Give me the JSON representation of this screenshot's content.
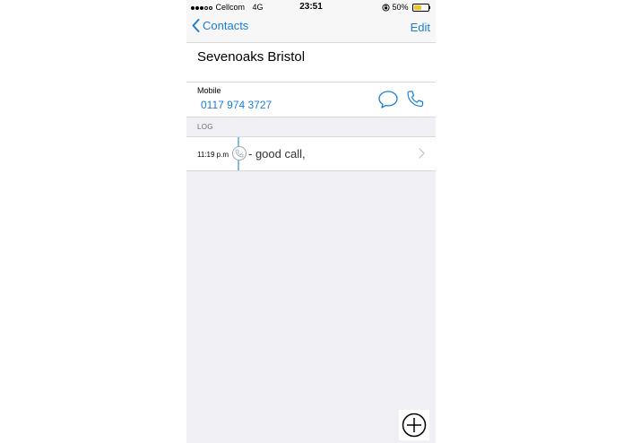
{
  "status_bar": {
    "carrier": "Cellcom",
    "network": "4G",
    "time": "23:51",
    "battery_percent": "50%",
    "battery_level": 0.5
  },
  "nav": {
    "back_label": "Contacts",
    "edit_label": "Edit"
  },
  "contact": {
    "name": "Sevenoaks Bristol",
    "phone_label": "Mobile",
    "phone_number": "0117 974 3727"
  },
  "log": {
    "header": "LOG",
    "entries": [
      {
        "time": "11:19 p.m",
        "note": "- good call,"
      }
    ]
  },
  "colors": {
    "accent": "#1a7fd6",
    "background": "#efeff4",
    "timeline": "#7fbde7",
    "battery": "#f3c324"
  }
}
